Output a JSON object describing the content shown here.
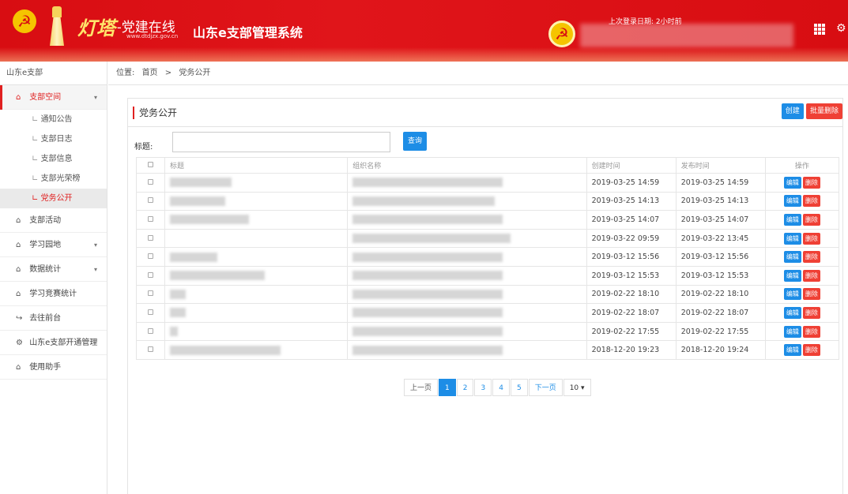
{
  "header": {
    "brand": "灯塔",
    "brand_sub": "-党建在线",
    "brand_url": "www.dtdjzx.gov.cn",
    "system_name": "山东e支部管理系统",
    "login_time": "上次登录日期: 2小时前"
  },
  "sidebar": {
    "title": "山东e支部",
    "menu": [
      {
        "label": "支部空间",
        "icon": "house-icon",
        "expanded": true,
        "active": true,
        "children": [
          "通知公告",
          "支部日志",
          "支部信息",
          "支部光荣榜",
          "党务公开"
        ],
        "selected_child": 4
      },
      {
        "label": "支部活动",
        "icon": "house-icon"
      },
      {
        "label": "学习园地",
        "icon": "house-icon",
        "has_arrow": true
      },
      {
        "label": "数据统计",
        "icon": "house-icon",
        "has_arrow": true
      },
      {
        "label": "学习竞赛统计",
        "icon": "house-icon"
      },
      {
        "label": "去往前台",
        "icon": "exit-arrow-icon"
      },
      {
        "label": "山东e支部开通管理",
        "icon": "gear-icon"
      },
      {
        "label": "使用助手",
        "icon": "house-icon"
      }
    ]
  },
  "breadcrumb": {
    "prefix": "位置:",
    "home": "首页",
    "separator": ">",
    "current": "党务公开"
  },
  "panel": {
    "title": "党务公开",
    "create_label": "创建",
    "batch_delete_label": "批量删除",
    "search_label": "标题:",
    "search_value": "",
    "search_button": "查询"
  },
  "table": {
    "headers": [
      "标题",
      "组织名称",
      "创建时间",
      "发布时间",
      "操作"
    ],
    "edit_label": "编辑",
    "delete_label": "删除",
    "rows": [
      {
        "created": "2019-03-25 14:59",
        "published": "2019-03-25 14:59"
      },
      {
        "created": "2019-03-25 14:13",
        "published": "2019-03-25 14:13"
      },
      {
        "created": "2019-03-25 14:07",
        "published": "2019-03-25 14:07"
      },
      {
        "created": "2019-03-22 09:59",
        "published": "2019-03-22 13:45"
      },
      {
        "created": "2019-03-12 15:56",
        "published": "2019-03-12 15:56"
      },
      {
        "created": "2019-03-12 15:53",
        "published": "2019-03-12 15:53"
      },
      {
        "created": "2019-02-22 18:10",
        "published": "2019-02-22 18:10"
      },
      {
        "created": "2019-02-22 18:07",
        "published": "2019-02-22 18:07"
      },
      {
        "created": "2019-02-22 17:55",
        "published": "2019-02-22 17:55"
      },
      {
        "created": "2018-12-20 19:23",
        "published": "2018-12-20 19:24"
      }
    ]
  },
  "pager": {
    "prev": "上一页",
    "pages": [
      "1",
      "2",
      "3",
      "4",
      "5"
    ],
    "current_page": "1",
    "next": "下一页",
    "page_size": "10"
  },
  "colors": {
    "header_red": "#d80d12",
    "accent_blue": "#1d8de6",
    "danger_red": "#ef4035"
  }
}
